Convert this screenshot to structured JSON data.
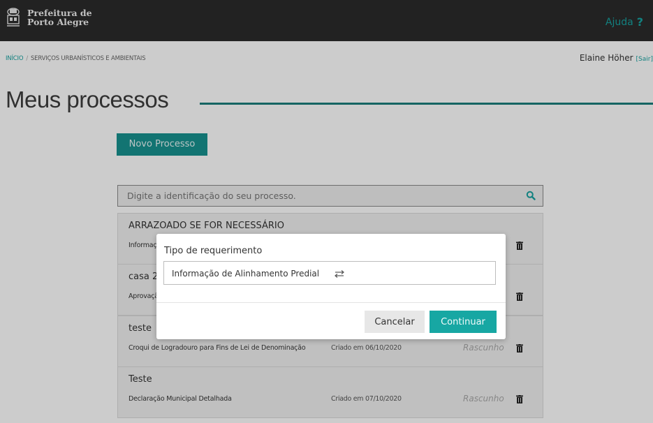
{
  "header": {
    "brand_line1": "Prefeitura de",
    "brand_line2": "Porto Alegre",
    "help_label": "Ajuda",
    "help_icon": "?"
  },
  "breadcrumb": {
    "home": "Início",
    "separator": "/",
    "current": "Serviços Urbanísticos e Ambientais"
  },
  "user": {
    "name": "Elaine Höher",
    "logout": "[Sair]"
  },
  "page": {
    "title": "Meus processos",
    "new_process_label": "Novo Processo"
  },
  "search": {
    "placeholder": "Digite a identificação do seu processo."
  },
  "processes": [
    {
      "title": "ARRAZOADO SE FOR NECESSÁRIO",
      "type": "Informação de Alinhamento Predial",
      "date": "",
      "status": ""
    },
    {
      "title": "casa 2",
      "type": "Aprovação de Projeto",
      "date": "",
      "status": ""
    },
    {
      "title": "teste",
      "type": "Croqui de Logradouro para Fins de Lei de Denominação",
      "date": "Criado em 06/10/2020",
      "status": "Rascunho"
    },
    {
      "title": "Teste",
      "type": "Declaração Municipal Detalhada",
      "date": "Criado em 07/10/2020",
      "status": "Rascunho"
    }
  ],
  "modal": {
    "label": "Tipo de requerimento",
    "selected": "Informação de Alinhamento Predial",
    "cancel_label": "Cancelar",
    "continue_label": "Continuar"
  },
  "colors": {
    "accent": "#17a2a0",
    "topbar": "#2b2b2b",
    "title_rule": "#1b7e7b"
  }
}
